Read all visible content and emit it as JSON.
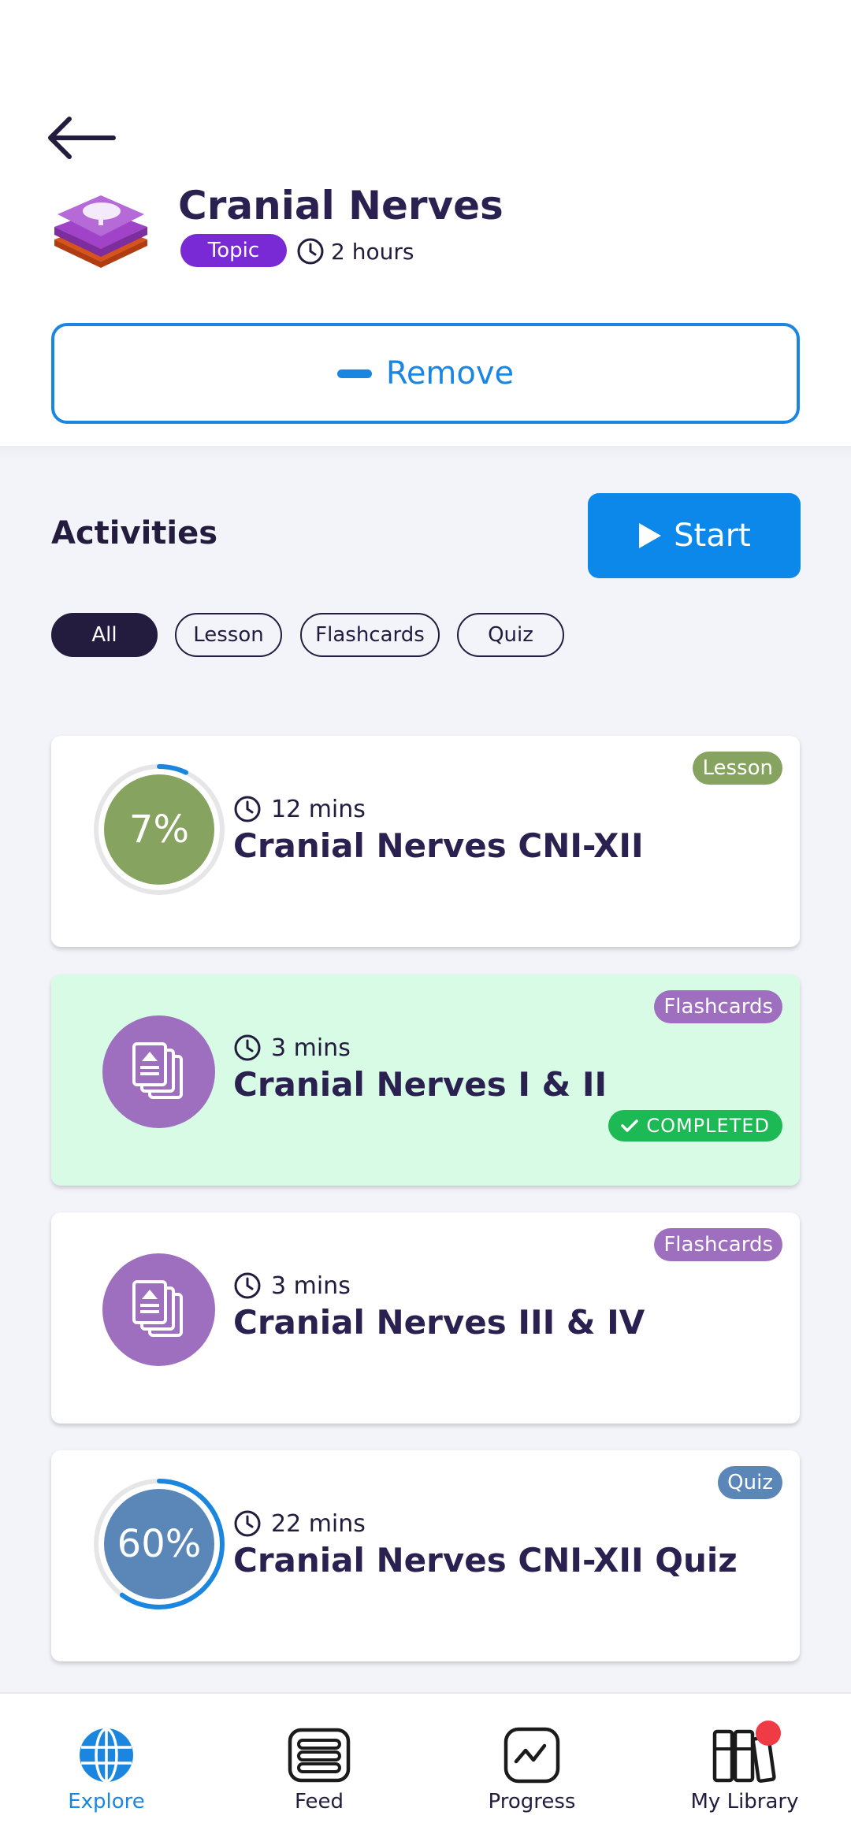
{
  "header": {
    "title": "Cranial Nerves",
    "badge": "Topic",
    "duration": "2 hours",
    "remove_label": "Remove"
  },
  "activities": {
    "title": "Activities",
    "start_label": "Start",
    "filters": [
      "All",
      "Lesson",
      "Flashcards",
      "Quiz"
    ],
    "selected_filter": "All",
    "items": [
      {
        "tag": "Lesson",
        "tag_color": "#86a35f",
        "time": "12 mins",
        "title": "Cranial Nerves CNI-XII",
        "progress_label": "7%",
        "progress": 0.07,
        "circle_color": "#86a35f",
        "completed": false
      },
      {
        "tag": "Flashcards",
        "tag_color": "#9e6fbe",
        "time": "3 mins",
        "title": "Cranial Nerves I & II",
        "icon": "flashcards-icon",
        "completed": true,
        "completed_label": "COMPLETED"
      },
      {
        "tag": "Flashcards",
        "tag_color": "#9e6fbe",
        "time": "3 mins",
        "title": "Cranial Nerves III & IV",
        "icon": "flashcards-icon",
        "completed": false
      },
      {
        "tag": "Quiz",
        "tag_color": "#5a86b8",
        "time": "22 mins",
        "title": "Cranial Nerves CNI-XII Quiz",
        "progress_label": "60%",
        "progress": 0.6,
        "circle_color": "#5a86b8",
        "completed": false
      }
    ]
  },
  "nav": {
    "items": [
      {
        "label": "Explore",
        "icon": "globe-icon",
        "active": true
      },
      {
        "label": "Feed",
        "icon": "feed-icon",
        "active": false
      },
      {
        "label": "Progress",
        "icon": "progress-chart-icon",
        "active": false
      },
      {
        "label": "My Library",
        "icon": "library-icon",
        "active": false,
        "has_notification": true
      }
    ]
  },
  "colors": {
    "accent": "#1a86e0",
    "topic_badge": "#7a2ad4",
    "completed": "#1db954",
    "text_dark": "#231c3e"
  }
}
